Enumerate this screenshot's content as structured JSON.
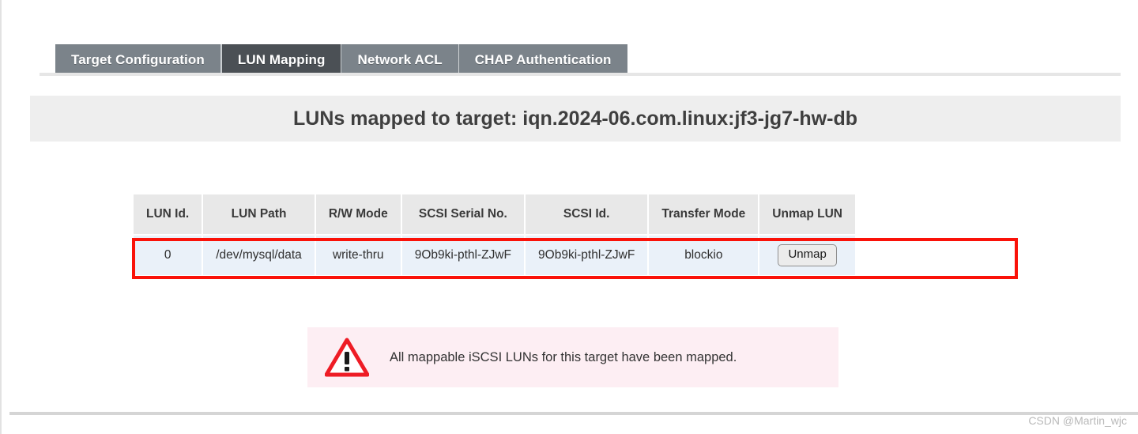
{
  "tabs": [
    {
      "label": "Target Configuration",
      "active": false
    },
    {
      "label": "LUN Mapping",
      "active": true
    },
    {
      "label": "Network ACL",
      "active": false
    },
    {
      "label": "CHAP Authentication",
      "active": false
    }
  ],
  "header": {
    "title": "LUNs mapped to target: iqn.2024-06.com.linux:jf3-jg7-hw-db",
    "target_iqn": "iqn.2024-06.com.linux:jf3-jg7-hw-db"
  },
  "table": {
    "columns": [
      "LUN Id.",
      "LUN Path",
      "R/W Mode",
      "SCSI Serial No.",
      "SCSI Id.",
      "Transfer Mode",
      "Unmap LUN"
    ],
    "rows": [
      {
        "lun_id": "0",
        "lun_path": "/dev/mysql/data",
        "rw_mode": "write-thru",
        "scsi_serial_no": "9Ob9ki-pthl-ZJwF",
        "scsi_id": "9Ob9ki-pthl-ZJwF",
        "transfer_mode": "blockio",
        "unmap_label": "Unmap"
      }
    ]
  },
  "notice": {
    "icon": "warning-triangle-icon",
    "message": "All mappable iSCSI LUNs for this target have been mapped."
  },
  "watermark": "CSDN @Martin_wjc",
  "colors": {
    "tab_inactive_bg": "#7b838a",
    "tab_active_bg": "#4b5055",
    "title_band_bg": "#eeeeee",
    "table_header_bg": "#e8e8e8",
    "table_row_bg": "#eaf1f9",
    "highlight_border": "#fa1209",
    "notice_bg": "#fdeef3",
    "notice_icon": "#ee1c25"
  }
}
